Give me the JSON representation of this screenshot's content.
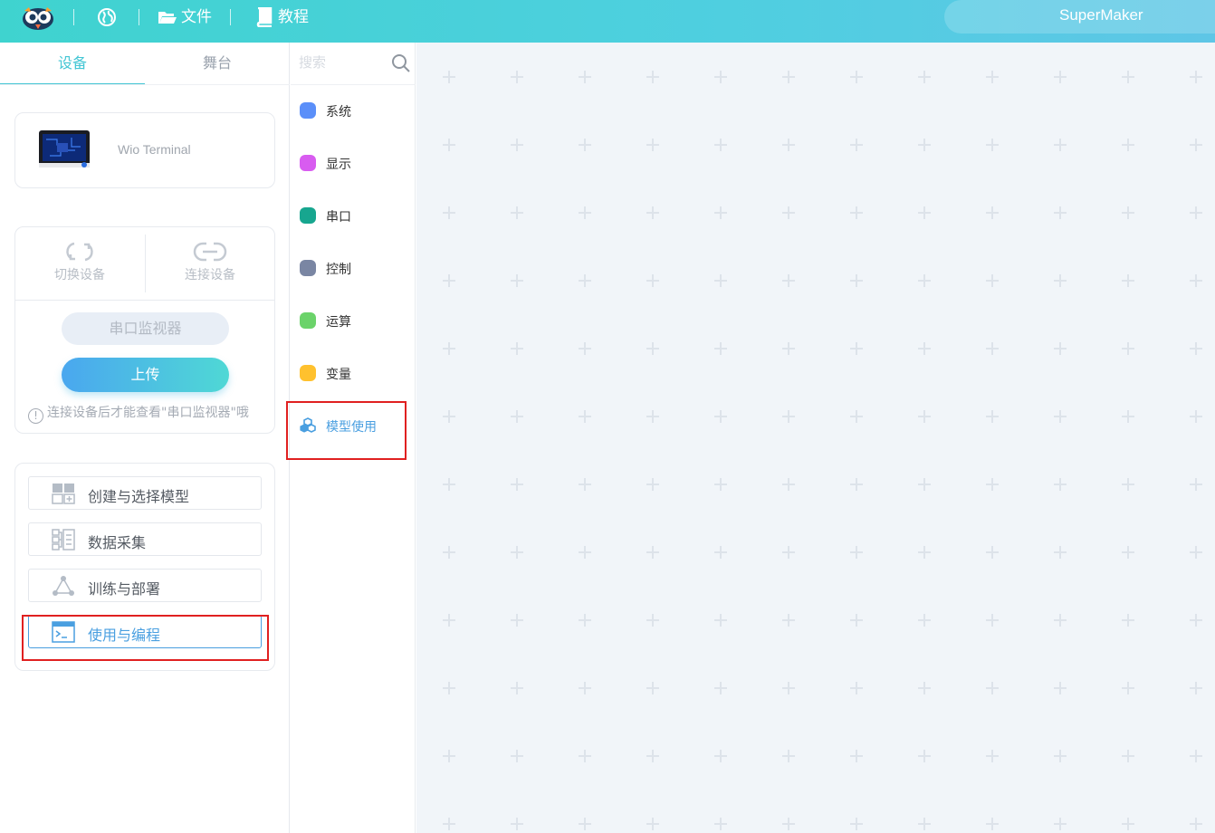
{
  "topbar": {
    "file_label": "文件",
    "tutorial_label": "教程",
    "user_name": "SuperMaker"
  },
  "left_panel": {
    "tabs": [
      {
        "label": "设备",
        "active": true
      },
      {
        "label": "舞台",
        "active": false
      }
    ],
    "device": {
      "name": "Wio Terminal"
    },
    "controls": {
      "switch_device": "切换设备",
      "connect_device": "连接设备",
      "serial_monitor": "串口监视器",
      "upload": "上传",
      "hint": "连接设备后才能查看\"串口监视器\"哦"
    },
    "model_steps": [
      {
        "label": "创建与选择模型",
        "icon": "grid-add-icon"
      },
      {
        "label": "数据采集",
        "icon": "data-collect-icon"
      },
      {
        "label": "训练与部署",
        "icon": "network-icon"
      },
      {
        "label": "使用与编程",
        "icon": "terminal-window-icon",
        "active": true
      }
    ]
  },
  "category_panel": {
    "search_placeholder": "搜索",
    "categories": [
      {
        "label": "系统",
        "color": "#5b8ff9"
      },
      {
        "label": "显示",
        "color": "#d85cf0"
      },
      {
        "label": "串口",
        "color": "#17a68f"
      },
      {
        "label": "控制",
        "color": "#7a86a3"
      },
      {
        "label": "运算",
        "color": "#6bd36a"
      },
      {
        "label": "变量",
        "color": "#ffc12e"
      },
      {
        "label": "模型使用",
        "color": "#4a9fe0",
        "icon": "cubes-icon",
        "active": true
      }
    ]
  },
  "workspace": {
    "grid_mark_color": "#dde3ea"
  }
}
